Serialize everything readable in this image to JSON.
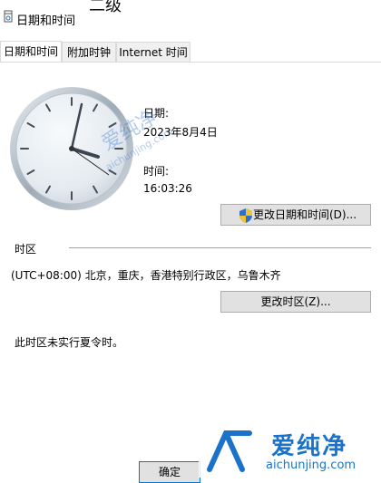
{
  "window": {
    "title": "日期和时间",
    "bg_glyph": "二级"
  },
  "tabs": [
    {
      "label": "日期和时间",
      "active": true
    },
    {
      "label": "附加时钟",
      "active": false
    },
    {
      "label": "Internet 时间",
      "active": false
    }
  ],
  "datetime": {
    "date_label": "日期:",
    "date_value": "2023年8月4日",
    "time_label": "时间:",
    "time_value": "16:03:26",
    "change_button": "更改日期和时间(D)..."
  },
  "timezone": {
    "section_label": "时区",
    "value": "(UTC+08:00) 北京，重庆，香港特别行政区，乌鲁木齐",
    "change_button": "更改时区(Z)...",
    "dst_note": "此时区未实行夏令时。"
  },
  "footer": {
    "ok_button": "确定"
  },
  "watermark": {
    "brand_cn": "爱纯净",
    "url": "aichunjing.com"
  },
  "colors": {
    "shield_blue": "#2d6fce",
    "shield_yellow": "#f1c232",
    "accent": "#0078d7"
  },
  "icons": {
    "title": "calendar-clock-icon",
    "uac": "uac-shield-icon"
  }
}
